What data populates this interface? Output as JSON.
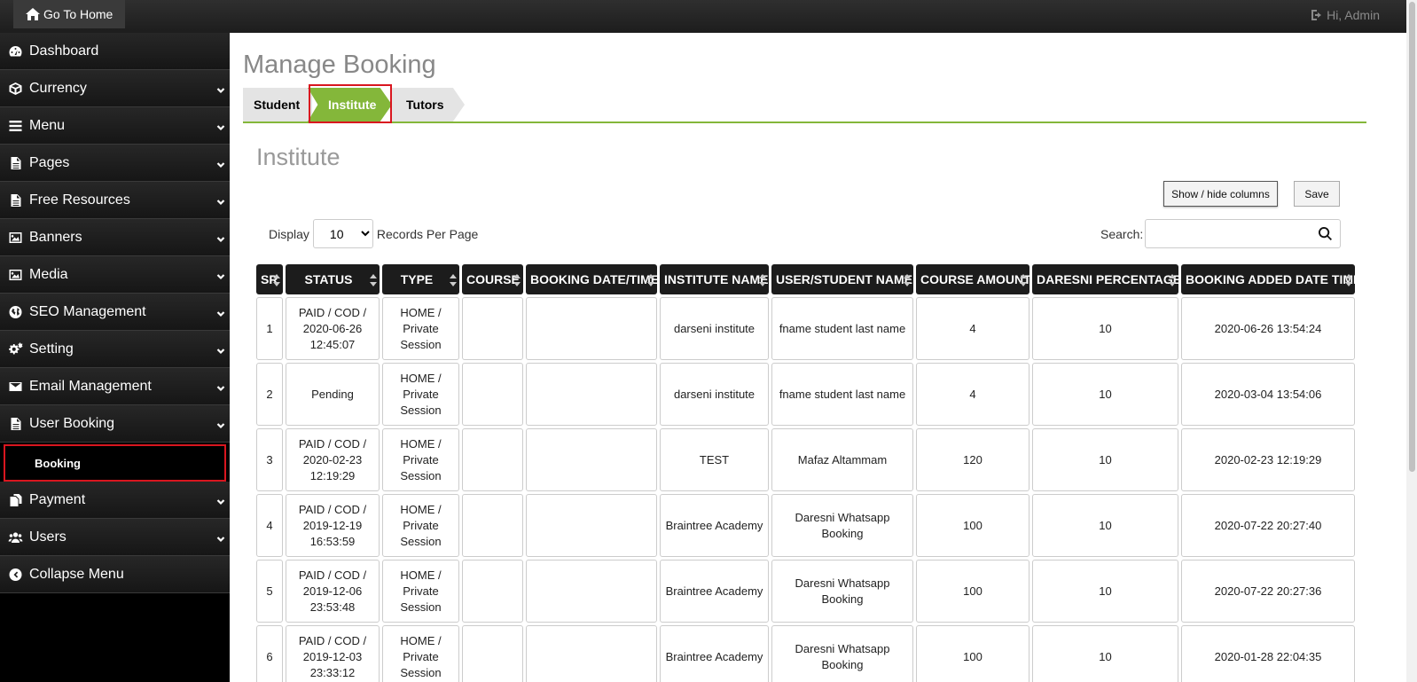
{
  "topbar": {
    "home_label": "Go To Home",
    "user_label": "Hi, Admin"
  },
  "sidebar": {
    "items": [
      {
        "label": "Dashboard",
        "icon": "dashboard-icon",
        "chevron": false
      },
      {
        "label": "Currency",
        "icon": "cube-icon",
        "chevron": true
      },
      {
        "label": "Menu",
        "icon": "bars-icon",
        "chevron": true
      },
      {
        "label": "Pages",
        "icon": "file-icon",
        "chevron": true
      },
      {
        "label": "Free Resources",
        "icon": "file-icon",
        "chevron": true
      },
      {
        "label": "Banners",
        "icon": "image-icon",
        "chevron": true
      },
      {
        "label": "Media",
        "icon": "image-icon",
        "chevron": true
      },
      {
        "label": "SEO Management",
        "icon": "globe-icon",
        "chevron": true
      },
      {
        "label": "Setting",
        "icon": "gears-icon",
        "chevron": true
      },
      {
        "label": "Email Management",
        "icon": "envelope-icon",
        "chevron": true
      },
      {
        "label": "User Booking",
        "icon": "file-icon",
        "chevron": true
      },
      {
        "label": "Payment",
        "icon": "files-icon",
        "chevron": true
      },
      {
        "label": "Users",
        "icon": "users-icon",
        "chevron": true
      },
      {
        "label": "Collapse Menu",
        "icon": "circle-left-icon",
        "chevron": false
      }
    ],
    "sub_item": "Booking"
  },
  "main": {
    "page_title": "Manage Booking",
    "tabs": [
      "Student",
      "Institute",
      "Tutors"
    ],
    "active_tab": "Institute",
    "section_title": "Institute",
    "show_hide_label": "Show / hide columns",
    "save_label": "Save",
    "display_label": "Display",
    "per_page": "10",
    "per_page_options": [
      "10"
    ],
    "records_label": "Records Per Page",
    "search_label": "Search:",
    "search_value": ""
  },
  "colors": {
    "accent": "#84b73a",
    "highlight": "#d9161f",
    "header_bg": "#1c1c1c"
  },
  "table": {
    "columns": [
      "SR",
      "STATUS",
      "TYPE",
      "COURSE",
      "BOOKING DATE/TIME",
      "INSTITUTE NAME",
      "USER/STUDENT NAME",
      "COURSE AMOUNT",
      "DARESNI PERCENTAGE",
      "BOOKING ADDED DATE TIME"
    ],
    "rows": [
      [
        "1",
        "PAID / COD / 2020-06-26 12:45:07",
        "HOME / Private Session",
        "",
        "",
        "darseni institute",
        "fname student last name",
        "4",
        "10",
        "2020-06-26 13:54:24"
      ],
      [
        "2",
        "Pending",
        "HOME / Private Session",
        "",
        "",
        "darseni institute",
        "fname student last name",
        "4",
        "10",
        "2020-03-04 13:54:06"
      ],
      [
        "3",
        "PAID / COD / 2020-02-23 12:19:29",
        "HOME / Private Session",
        "",
        "",
        "TEST",
        "Mafaz Altammam",
        "120",
        "10",
        "2020-02-23 12:19:29"
      ],
      [
        "4",
        "PAID / COD / 2019-12-19 16:53:59",
        "HOME / Private Session",
        "",
        "",
        "Braintree Academy",
        "Daresni Whatsapp Booking",
        "100",
        "10",
        "2020-07-22 20:27:40"
      ],
      [
        "5",
        "PAID / COD / 2019-12-06 23:53:48",
        "HOME / Private Session",
        "",
        "",
        "Braintree Academy",
        "Daresni Whatsapp Booking",
        "100",
        "10",
        "2020-07-22 20:27:36"
      ],
      [
        "6",
        "PAID / COD / 2019-12-03 23:33:12",
        "HOME / Private Session",
        "",
        "",
        "Braintree Academy",
        "Daresni Whatsapp Booking",
        "100",
        "10",
        "2020-01-28 22:04:35"
      ]
    ]
  }
}
